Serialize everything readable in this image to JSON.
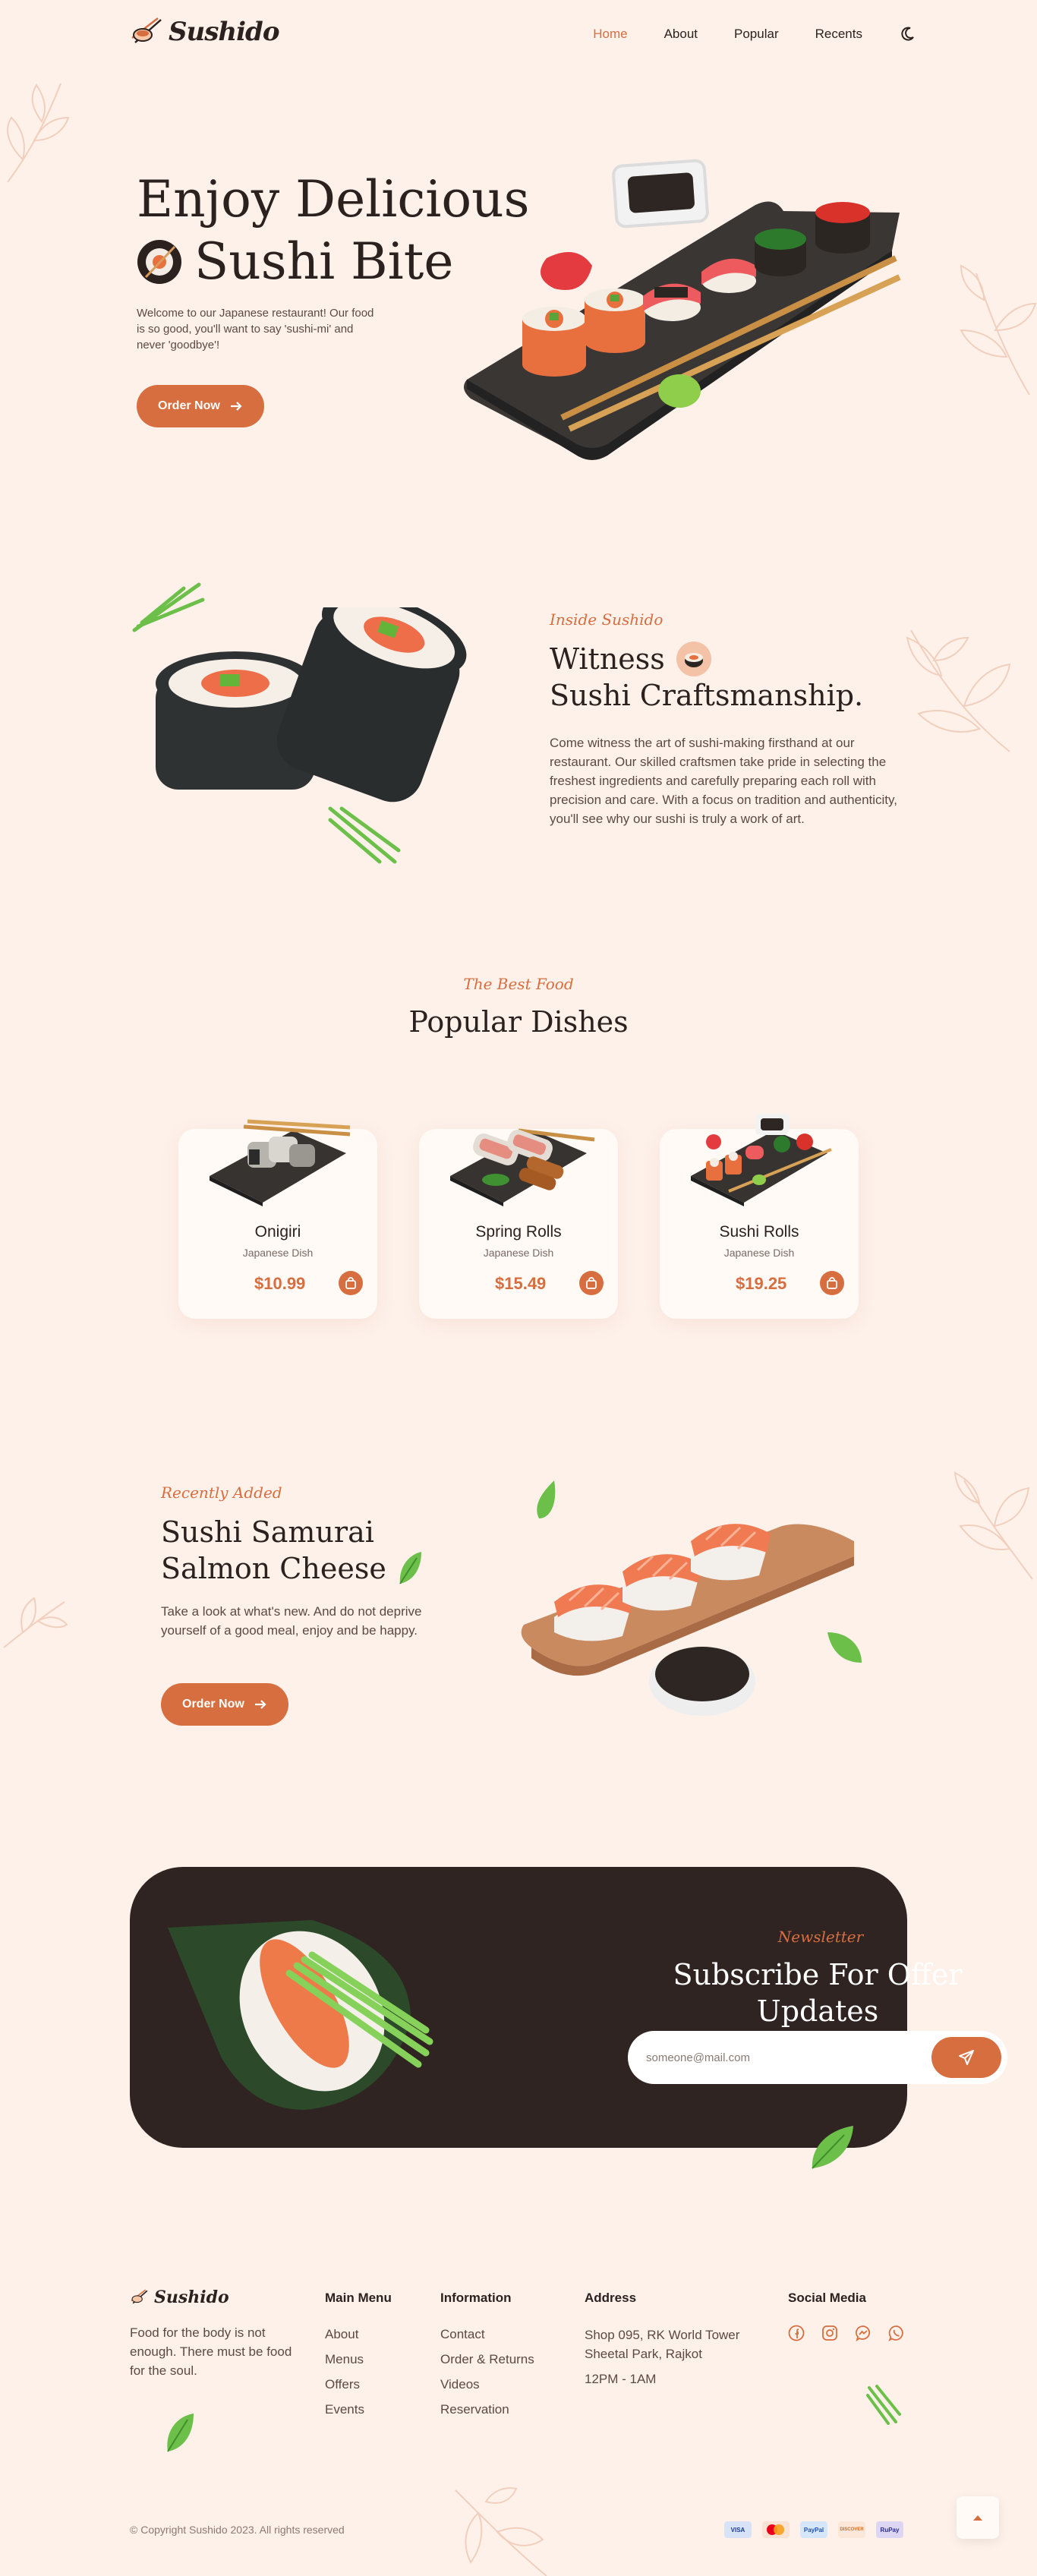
{
  "header": {
    "brand": "Sushido",
    "nav": [
      {
        "label": "Home",
        "active": true
      },
      {
        "label": "About",
        "active": false
      },
      {
        "label": "Popular",
        "active": false
      },
      {
        "label": "Recents",
        "active": false
      }
    ],
    "theme_icon": "moon-icon"
  },
  "hero": {
    "title_line1": "Enjoy Delicious",
    "title_line2": "Sushi Bite",
    "description": "Welcome to our Japanese restaurant! Our food is so good, you'll want to say 'sushi-mi' and never 'goodbye'!",
    "button": "Order Now"
  },
  "about": {
    "tag": "Inside Sushido",
    "title_line1": "Witness",
    "title_line2": "Sushi Craftsmanship.",
    "description": "Come witness the art of sushi-making firsthand at our restaurant. Our skilled craftsmen take pride in selecting the freshest ingredients and carefully preparing each roll with precision and care. With a focus on tradition and authenticity, you'll see why our sushi is truly a work of art."
  },
  "popular": {
    "tag": "The Best Food",
    "title": "Popular Dishes",
    "items": [
      {
        "name": "Onigiri",
        "type": "Japanese Dish",
        "price": "$10.99"
      },
      {
        "name": "Spring Rolls",
        "type": "Japanese Dish",
        "price": "$15.49"
      },
      {
        "name": "Sushi Rolls",
        "type": "Japanese Dish",
        "price": "$19.25"
      }
    ]
  },
  "recent": {
    "tag": "Recently Added",
    "title_line1": "Sushi Samurai",
    "title_line2": "Salmon Cheese",
    "description": "Take a look at what's new. And do not deprive yourself of a good meal, enjoy and be happy.",
    "button": "Order Now"
  },
  "newsletter": {
    "tag": "Newsletter",
    "title": "Subscribe For Offer Updates",
    "placeholder": "someone@mail.com"
  },
  "footer": {
    "brand": "Sushido",
    "tagline": "Food for the body is not enough. There must be food for the soul.",
    "main_menu": {
      "title": "Main Menu",
      "links": [
        "About",
        "Menus",
        "Offers",
        "Events"
      ]
    },
    "information": {
      "title": "Information",
      "links": [
        "Contact",
        "Order & Returns",
        "Videos",
        "Reservation"
      ]
    },
    "address": {
      "title": "Address",
      "line1": "Shop 095, RK World Tower",
      "line2": "Sheetal Park, Rajkot",
      "hours": "12PM - 1AM"
    },
    "social": {
      "title": "Social Media",
      "icons": [
        "facebook-icon",
        "instagram-icon",
        "messenger-icon",
        "whatsapp-icon"
      ]
    },
    "copyright": "© Copyright Sushido 2023. All rights reserved",
    "payments": [
      "VISA",
      "mastercard",
      "PayPal",
      "DISCOVER",
      "RuPay"
    ]
  },
  "colors": {
    "accent": "#d76e40",
    "background": "#fdf1ea",
    "dark": "#2f2421"
  }
}
